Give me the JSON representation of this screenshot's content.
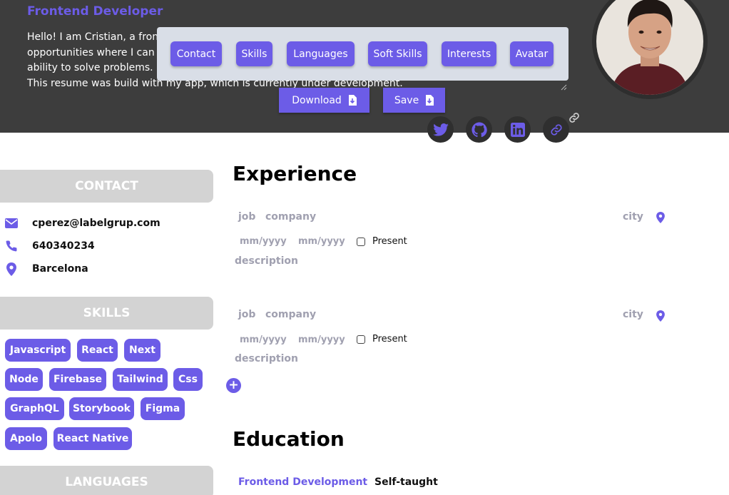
{
  "header": {
    "role": "Frontend Developer",
    "intro_lines": [
      "Hello! I am Cristian, a fron",
      "opportunities where I can",
      "ability to solve problems.",
      "This resume was build with my app, which is currently under development."
    ],
    "accent_color": "#6c5ce7",
    "background_color": "#3d3d3d"
  },
  "toolbar": {
    "items": [
      "Contact",
      "Skills",
      "Languages",
      "Soft Skills",
      "Interests",
      "Avatar"
    ]
  },
  "actions": {
    "download_label": "Download",
    "save_label": "Save"
  },
  "social": {
    "icons": [
      "twitter-icon",
      "github-icon",
      "linkedin-icon",
      "link-icon"
    ]
  },
  "sidebar": {
    "contact_heading": "CONTACT",
    "contact": {
      "email": "cperez@labelgrup.com",
      "phone": "640340234",
      "location": "Barcelona"
    },
    "skills_heading": "SKILLS",
    "skills": [
      "Javascript",
      "React",
      "Next",
      "Node",
      "Firebase",
      "Tailwind",
      "Css",
      "GraphQL",
      "Storybook",
      "Figma",
      "Apolo",
      "React Native"
    ],
    "languages_heading": "LANGUAGES"
  },
  "experience": {
    "title": "Experience",
    "entries": [
      {
        "job": "job",
        "company": "company",
        "city": "city",
        "start": "mm/yyyy",
        "end": "mm/yyyy",
        "present_label": "Present",
        "description": "description"
      },
      {
        "job": "job",
        "company": "company",
        "city": "city",
        "start": "mm/yyyy",
        "end": "mm/yyyy",
        "present_label": "Present",
        "description": "description"
      }
    ],
    "add_label": "+"
  },
  "education": {
    "title": "Education",
    "program": "Frontend Development",
    "school": "Self-taught"
  }
}
